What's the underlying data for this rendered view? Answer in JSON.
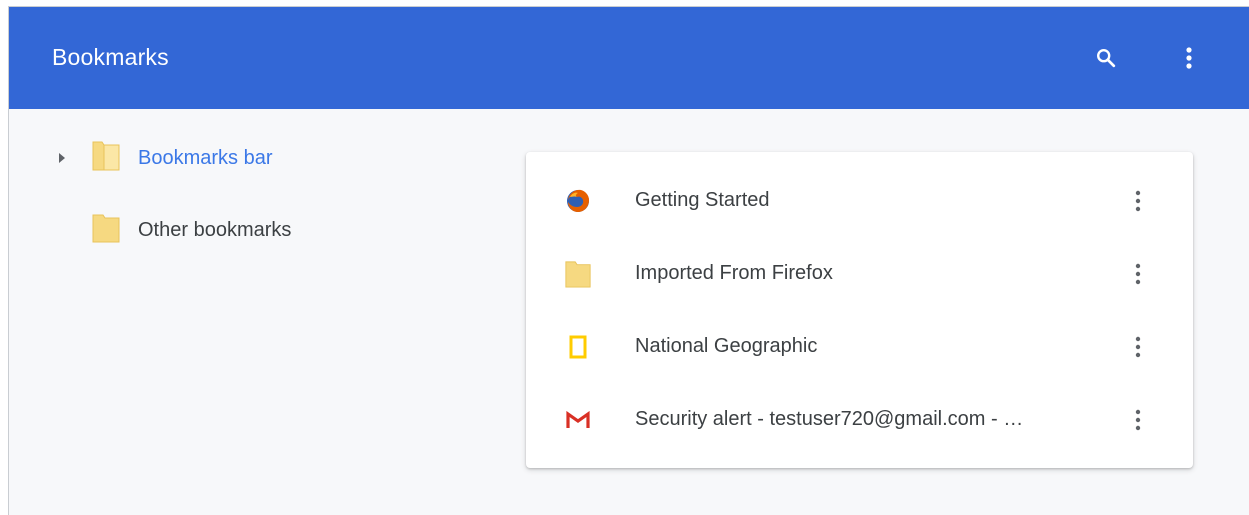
{
  "header": {
    "title": "Bookmarks",
    "color": "#3367d6",
    "search_icon": "search-icon",
    "menu_icon": "more-vert-icon"
  },
  "sidebar": {
    "items": [
      {
        "label": "Bookmarks bar",
        "selected": true,
        "expandable": true,
        "icon": "folder-open-icon"
      },
      {
        "label": "Other bookmarks",
        "selected": false,
        "expandable": false,
        "icon": "folder-icon"
      }
    ]
  },
  "bookmarks": {
    "items": [
      {
        "label": "Getting Started",
        "icon": "firefox-icon"
      },
      {
        "label": "Imported From Firefox",
        "icon": "folder-icon"
      },
      {
        "label": "National Geographic",
        "icon": "national-geographic-icon"
      },
      {
        "label": "Security alert - testuser720@gmail.com - …",
        "icon": "gmail-icon"
      }
    ],
    "more_icon": "more-vert-icon"
  },
  "colors": {
    "accent": "#3367d6",
    "selected_text": "#3b78e7",
    "folder": "#f6d981"
  }
}
